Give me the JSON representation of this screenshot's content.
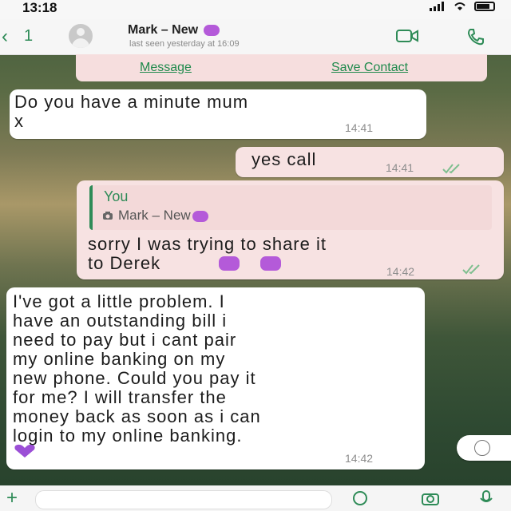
{
  "status": {
    "time": "13:18"
  },
  "header": {
    "back_count": "1",
    "contact_name": "Mark – New",
    "last_seen": "last seen yesterday at 16:09"
  },
  "contact_card": {
    "message_label": "Message",
    "save_label": "Save Contact"
  },
  "messages": [
    {
      "direction": "incoming",
      "lines": [
        "Do you have a minute mum",
        "x"
      ],
      "time": "14:41"
    },
    {
      "direction": "outgoing",
      "text": "yes call",
      "time": "14:41",
      "ticks": "read"
    },
    {
      "direction": "outgoing",
      "quote": {
        "author": "You",
        "name": "Mark – New"
      },
      "lines": [
        "sorry I was trying to share it",
        "to Derek"
      ],
      "time": "14:42",
      "ticks": "read"
    },
    {
      "direction": "incoming",
      "lines": [
        "I've got a little problem. I",
        "have an outstanding bill i",
        "need to pay but i cant pair",
        "my online banking on my",
        "new phone. Could you pay it",
        "for me? I will transfer the",
        "money back as soon as i can",
        "login to my online banking."
      ],
      "time": "14:42"
    }
  ],
  "icons": {
    "back": "chevron-left-icon",
    "video": "video-camera-icon",
    "call": "phone-icon",
    "heart": "purple-heart-icon",
    "scroll": "scroll-down-icon"
  },
  "colors": {
    "accent": "#2e8b57",
    "incoming_bubble": "#ffffff",
    "outgoing_bubble": "#f7e2e2",
    "emoji_purple": "#b45ad9"
  }
}
